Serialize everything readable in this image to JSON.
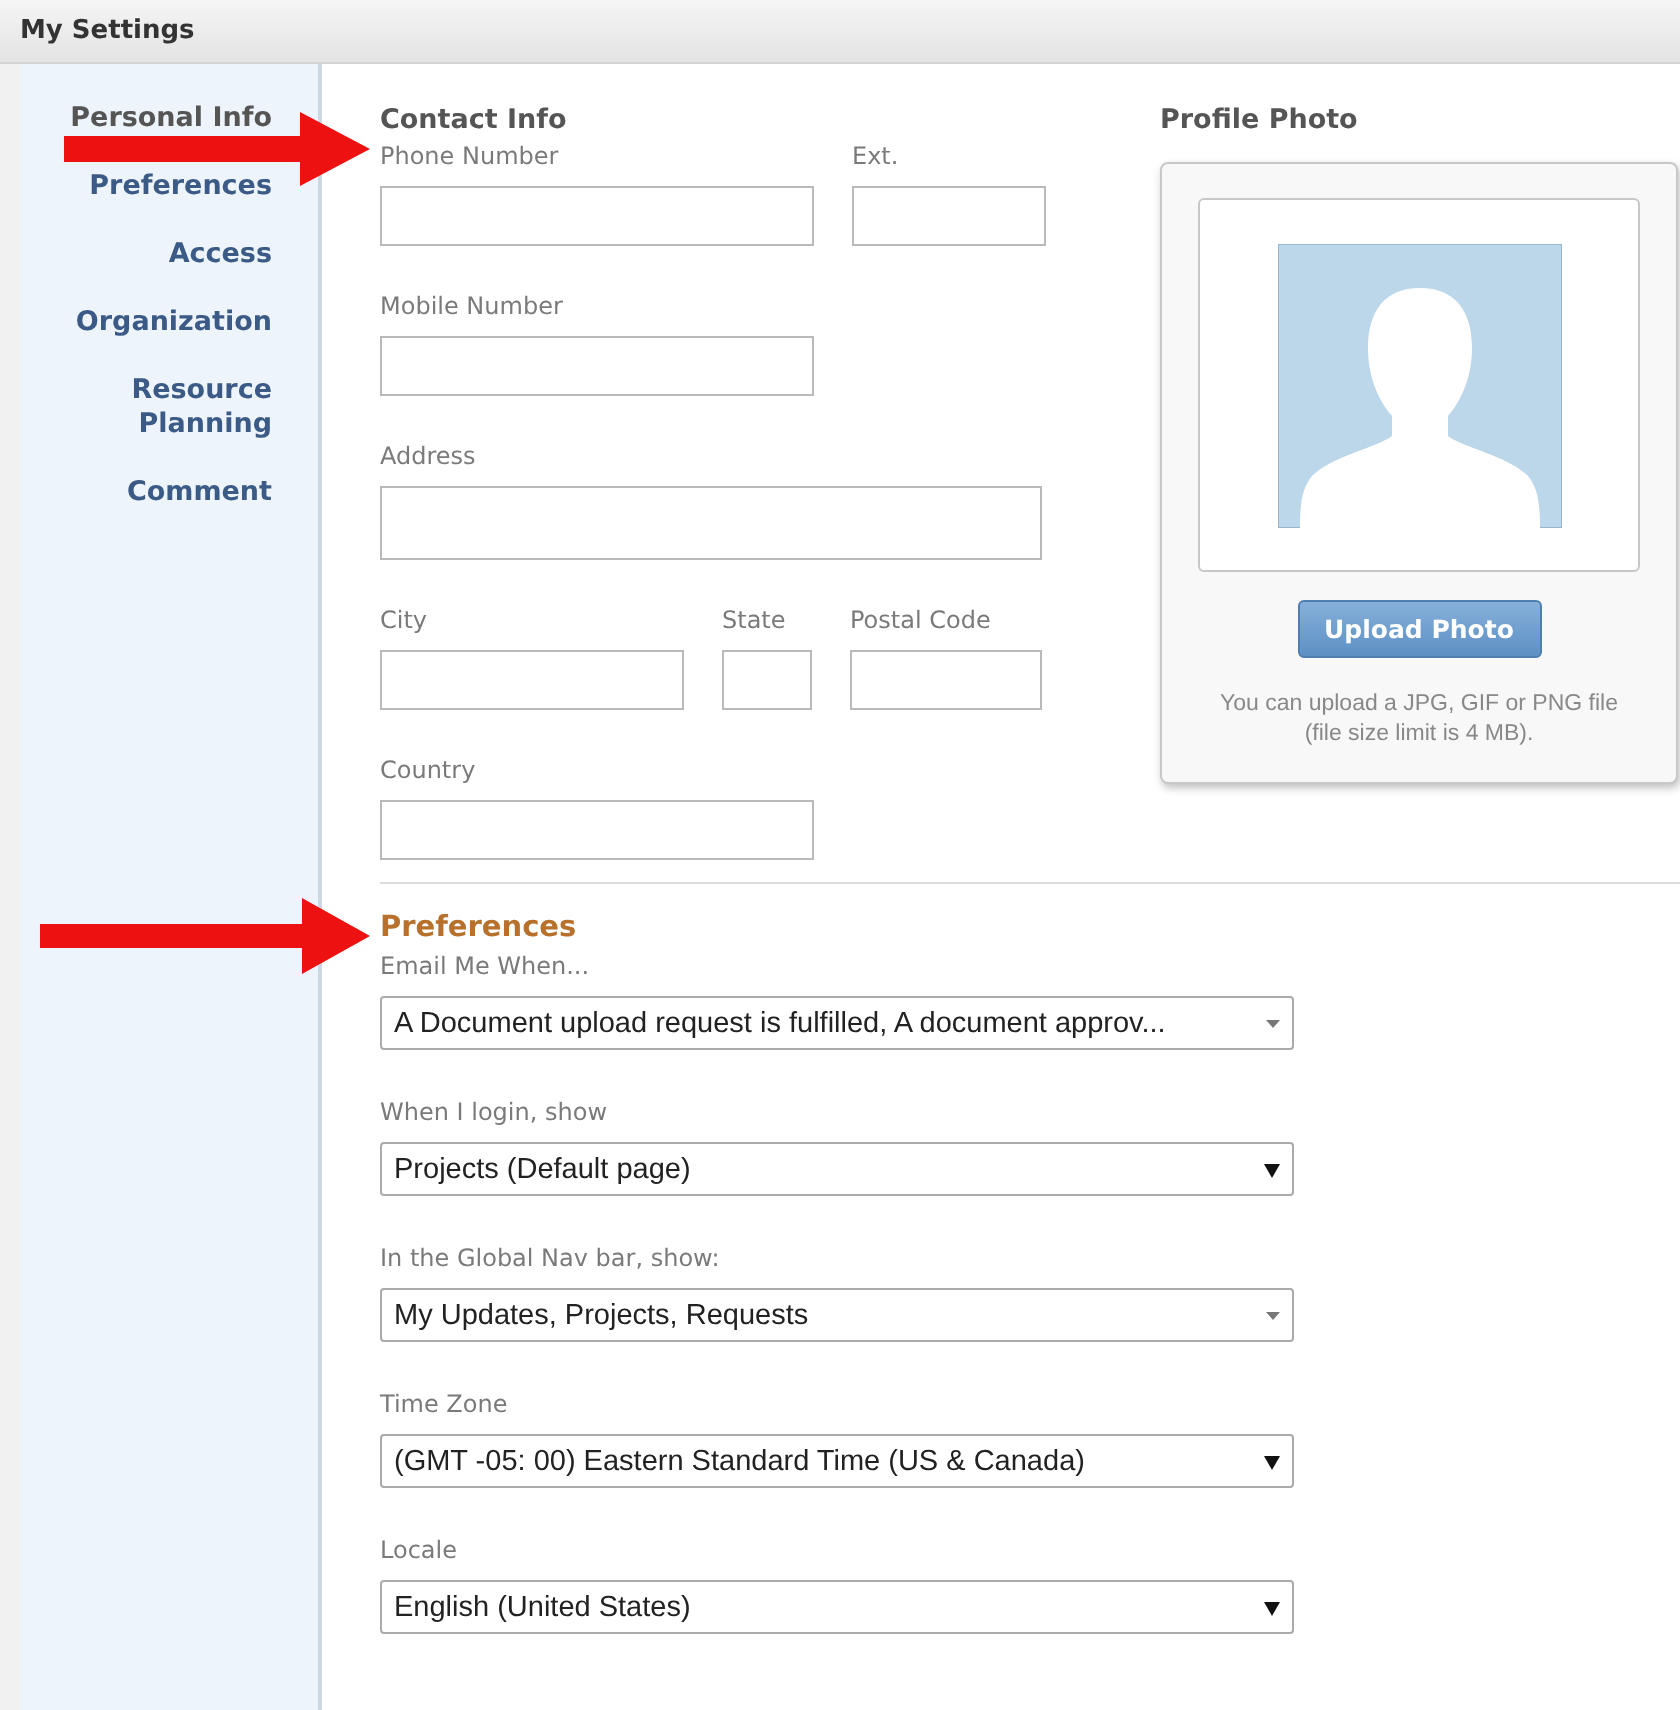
{
  "window": {
    "title": "My Settings"
  },
  "sidebar": {
    "items": [
      {
        "label": "Personal Info",
        "selected": true
      },
      {
        "label": "Preferences",
        "selected": false
      },
      {
        "label": "Access",
        "selected": false
      },
      {
        "label": "Organization",
        "selected": false
      },
      {
        "label": "Resource Planning",
        "selected": false
      },
      {
        "label": "Comment",
        "selected": false
      }
    ]
  },
  "contact_info": {
    "heading": "Contact Info",
    "rows": [
      {
        "fields": [
          {
            "label": "Phone Number"
          },
          {
            "label": "Ext."
          }
        ]
      },
      {
        "fields": [
          {
            "label": "Mobile Number"
          }
        ]
      },
      {
        "fields": [
          {
            "label": "Address"
          }
        ]
      },
      {
        "fields": [
          {
            "label": "City"
          },
          {
            "label": "State"
          },
          {
            "label": "Postal Code"
          }
        ]
      },
      {
        "fields": [
          {
            "label": "Country"
          }
        ]
      }
    ]
  },
  "profile_photo": {
    "heading": "Profile Photo",
    "button": "Upload Photo",
    "note": "You can upload a JPG, GIF or PNG file (file size limit is 4 MB)."
  },
  "preferences": {
    "heading": "Preferences",
    "fields": [
      {
        "label": "Email Me When...",
        "value": "A Document upload request is fulfilled, A document approv...",
        "kind": "multi"
      },
      {
        "label": "When I login, show",
        "value": "Projects (Default page)",
        "kind": "single"
      },
      {
        "label": "In the Global Nav bar, show:",
        "value": "My Updates, Projects, Requests",
        "kind": "multi"
      },
      {
        "label": "Time Zone",
        "value": "(GMT -05: 00) Eastern Standard Time (US & Canada)",
        "kind": "single"
      },
      {
        "label": "Locale",
        "value": "English (United States)",
        "kind": "single"
      }
    ]
  }
}
